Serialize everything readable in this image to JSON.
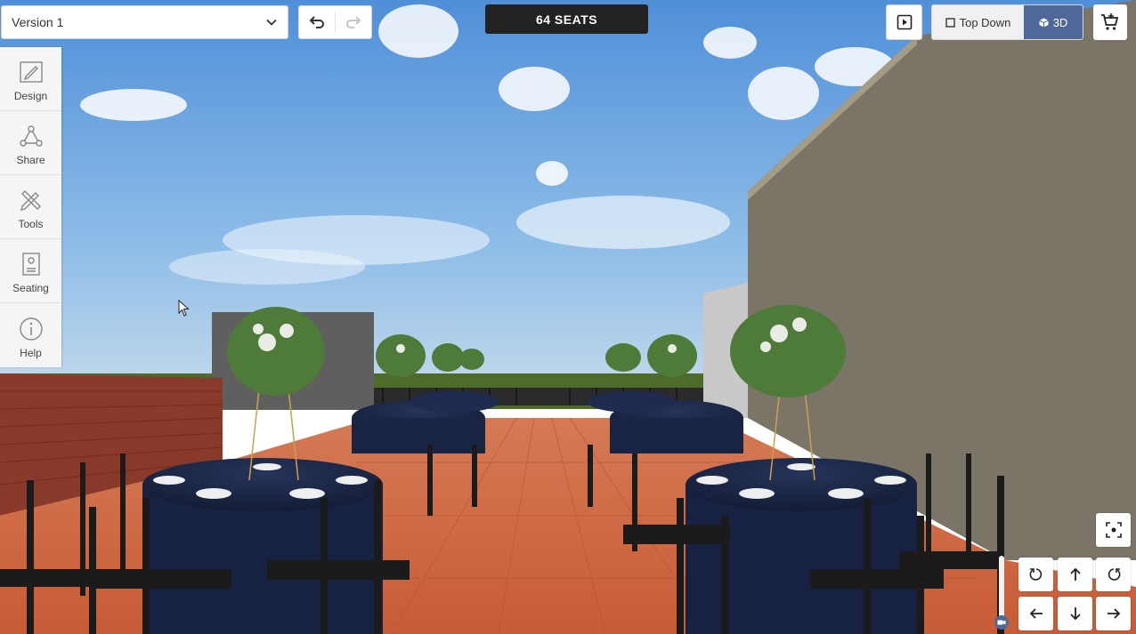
{
  "version_select": {
    "value": "Version 1"
  },
  "seats": {
    "label": "64 SEATS"
  },
  "view_toggle": {
    "top_down": "Top Down",
    "three_d": "3D",
    "active": "3D"
  },
  "sidebar": {
    "items": [
      {
        "label": "Design",
        "icon": "design-icon"
      },
      {
        "label": "Share",
        "icon": "share-icon"
      },
      {
        "label": "Tools",
        "icon": "tools-icon"
      },
      {
        "label": "Seating",
        "icon": "seating-icon"
      },
      {
        "label": "Help",
        "icon": "help-icon"
      }
    ]
  },
  "colors": {
    "accent": "#4e6899",
    "banner": "#222222",
    "sky": "#5f9be0",
    "tablecloth": "#1d2a4b",
    "terracotta": "#d0663e",
    "wall": "#7b7567"
  }
}
